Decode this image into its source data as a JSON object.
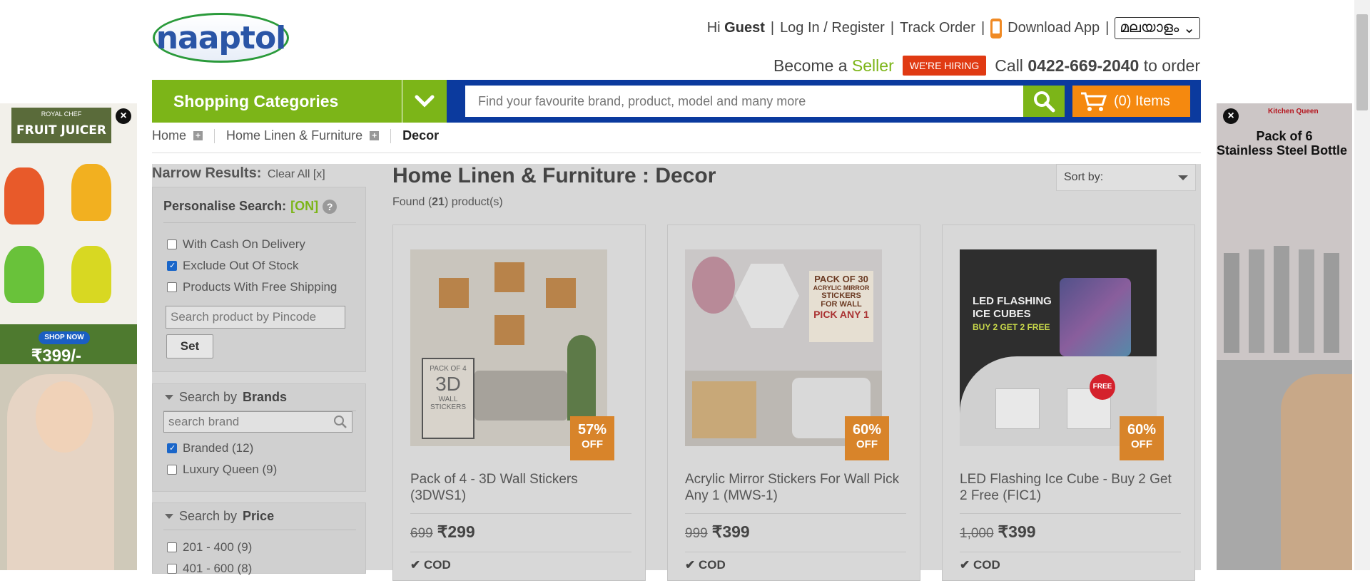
{
  "brand": {
    "logo_text": "naaptol"
  },
  "header": {
    "greeting_prefix": "Hi",
    "greeting_user": "Guest",
    "login": "Log In / Register",
    "track": "Track Order",
    "download": "Download App",
    "language": "മലയാളം",
    "become_a": "Become a",
    "seller": "Seller",
    "hiring": "WE'RE HIRING",
    "call_prefix": "Call",
    "phone": "0422-669-2040",
    "call_suffix": "to order"
  },
  "nav": {
    "categories": "Shopping Categories",
    "search_placeholder": "Find your favourite brand, product, model and many more",
    "cart": "(0) Items"
  },
  "breadcrumb": {
    "home": "Home",
    "section": "Home Linen & Furniture",
    "current": "Decor"
  },
  "sidebar": {
    "narrow": "Narrow Results:",
    "clear": "Clear All [x]",
    "personalise": "Personalise Search:",
    "personalise_state": "[ON]",
    "filters": [
      {
        "label": "With Cash On Delivery",
        "checked": false
      },
      {
        "label": "Exclude Out Of Stock",
        "checked": true
      },
      {
        "label": "Products With Free Shipping",
        "checked": false
      }
    ],
    "pincode_placeholder": "Search product by Pincode",
    "set": "Set",
    "brands_prefix": "Search by",
    "brands_title": "Brands",
    "brand_search_placeholder": "search brand",
    "brands": [
      {
        "label": "Branded (12)",
        "checked": true
      },
      {
        "label": "Luxury Queen (9)",
        "checked": false
      }
    ],
    "price_prefix": "Search by",
    "price_title": "Price",
    "prices": [
      {
        "label": "201 - 400 (9)",
        "checked": false
      },
      {
        "label": "401 - 600 (8)",
        "checked": false
      }
    ]
  },
  "main": {
    "title": "Home Linen & Furniture : Decor",
    "found_prefix": "Found (",
    "found_count": "21",
    "found_suffix": ") product(s)",
    "sort_label": "Sort by:"
  },
  "products": [
    {
      "name": "Pack of 4 - 3D Wall Stickers (3DWS1)",
      "mrp": "699",
      "price": "₹299",
      "discount": "57%",
      "off": "OFF",
      "cod": "COD",
      "img_text": [
        "PACK OF 4",
        "3D",
        "WALL",
        "STICKERS"
      ]
    },
    {
      "name": "Acrylic Mirror Stickers For Wall Pick Any 1 (MWS-1)",
      "mrp": "999",
      "price": "₹399",
      "discount": "60%",
      "off": "OFF",
      "cod": "COD",
      "img_text": [
        "PACK OF 30",
        "ACRYLIC MIRROR",
        "STICKERS",
        "FOR WALL",
        "PICK ANY 1"
      ]
    },
    {
      "name": "LED Flashing Ice Cube - Buy 2 Get 2 Free (FIC1)",
      "mrp": "1,000",
      "price": "₹399",
      "discount": "60%",
      "off": "OFF",
      "cod": "COD",
      "img_text": [
        "LED FLASHING",
        "ICE CUBES",
        "BUY 2 GET 2 FREE",
        "FREE"
      ]
    }
  ],
  "ads": {
    "left": {
      "brand": "ROYAL CHEF",
      "title": "FRUIT JUICER",
      "cta": "SHOP NOW",
      "price": "₹399/-"
    },
    "right": {
      "brand": "Kitchen Queen",
      "title_1": "Pack of 6",
      "title_2": "Stainless Steel Bottle"
    }
  },
  "colors": {
    "green": "#7cb518",
    "blue": "#0b3a9e",
    "orange": "#f5890f",
    "badge": "#d8842a"
  }
}
